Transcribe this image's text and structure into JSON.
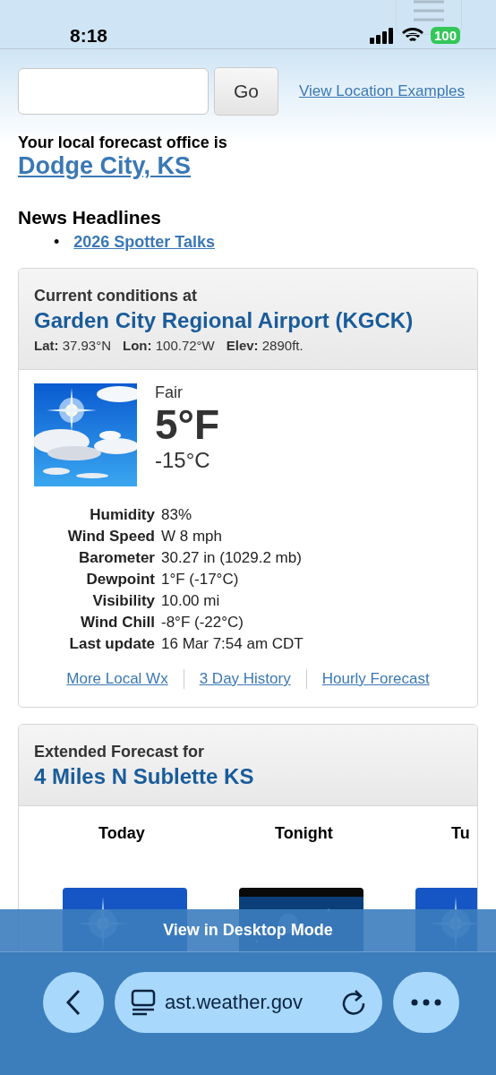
{
  "status_bar": {
    "time": "8:18",
    "battery": "100"
  },
  "search": {
    "button": "Go",
    "link": "View Location Examples"
  },
  "office": {
    "intro": "Your local forecast office is",
    "name": "Dodge City, KS"
  },
  "news": {
    "title": "News Headlines",
    "items": [
      {
        "bullet": "•",
        "text": "2026 Spotter Talks"
      }
    ]
  },
  "current": {
    "heading": "Current conditions at",
    "station": "Garden City Regional Airport (KGCK)",
    "coords": [
      {
        "label": "Lat:",
        "value": "37.93°N"
      },
      {
        "label": "Lon:",
        "value": "100.72°W"
      },
      {
        "label": "Elev:",
        "value": "2890ft."
      }
    ],
    "condition": "Fair",
    "temp_f": "5°F",
    "temp_c": "-15°C",
    "details": [
      {
        "label": "Humidity",
        "value": "83%"
      },
      {
        "label": "Wind Speed",
        "value": "W 8 mph"
      },
      {
        "label": "Barometer",
        "value": "30.27 in (1029.2 mb)"
      },
      {
        "label": "Dewpoint",
        "value": "1°F (-17°C)"
      },
      {
        "label": "Visibility",
        "value": "10.00 mi"
      },
      {
        "label": "Wind Chill",
        "value": "-8°F (-22°C)"
      },
      {
        "label": "Last update",
        "value": "16 Mar 7:54 am CDT"
      }
    ],
    "links": [
      "More Local Wx",
      "3 Day History",
      "Hourly Forecast"
    ]
  },
  "extended": {
    "heading": "Extended Forecast for",
    "place": "4 Miles N Sublette KS",
    "periods": [
      {
        "name": "Today",
        "kind": "day"
      },
      {
        "name": "Tonight",
        "kind": "night"
      },
      {
        "name": "Tu",
        "kind": "day"
      }
    ]
  },
  "desktop_banner": "View in Desktop Mode",
  "browser": {
    "url": "ast.weather.gov"
  }
}
